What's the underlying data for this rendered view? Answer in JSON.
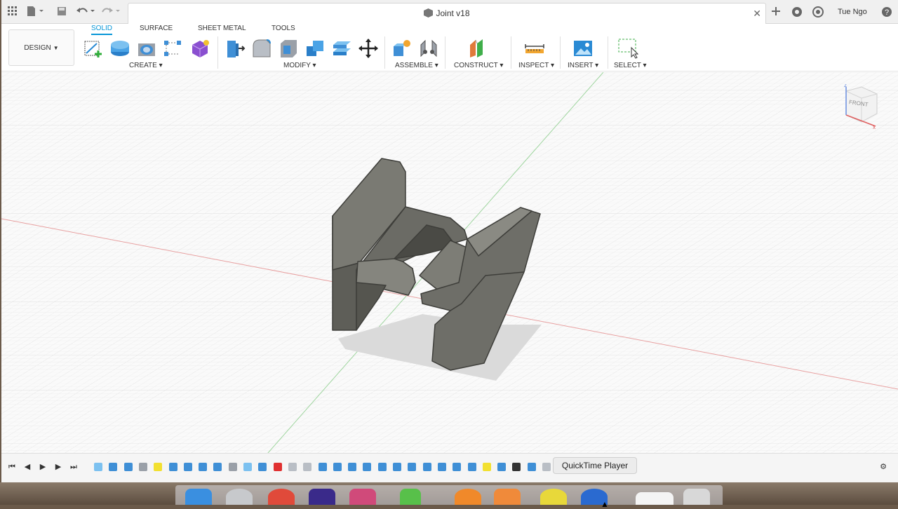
{
  "window": {
    "doc_title": "Joint v18",
    "user_name": "Tue Ngo"
  },
  "toolbar": {
    "workspace_label": "DESIGN",
    "tabs": [
      "SOLID",
      "SURFACE",
      "SHEET METAL",
      "TOOLS"
    ],
    "active_tab": "SOLID",
    "groups": [
      "CREATE",
      "MODIFY",
      "ASSEMBLE",
      "CONSTRUCT",
      "INSPECT",
      "INSERT",
      "SELECT"
    ]
  },
  "viewcube": {
    "face_label": "FRONT"
  },
  "tooltip": {
    "text": "QuickTime Player"
  },
  "colors": {
    "accent": "#0696d7",
    "model": "#6a6a64",
    "grid": "#e4e4e4"
  }
}
